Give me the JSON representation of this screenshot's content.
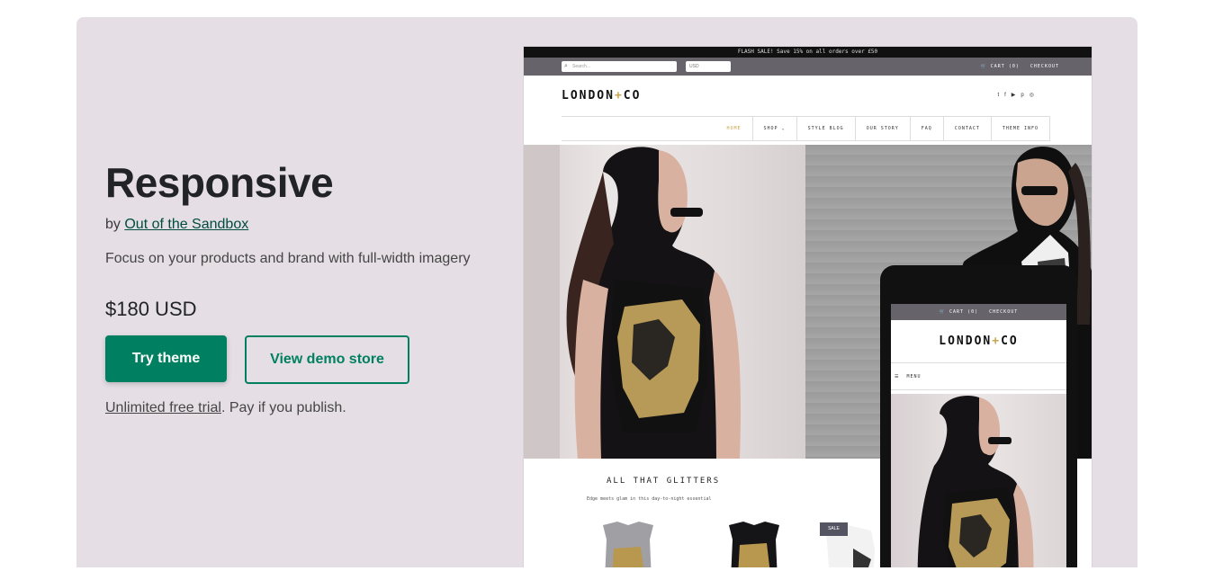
{
  "theme": {
    "title": "Responsive",
    "by_prefix": "by ",
    "author": "Out of the Sandbox",
    "description": "Focus on your products and brand with full-width imagery",
    "price": "$180 USD",
    "try_label": "Try theme",
    "demo_label": "View demo store",
    "trial_link": "Unlimited free trial",
    "trial_rest": ". Pay if you publish."
  },
  "preview": {
    "flash": "FLASH SALE! Save 15% on all orders over £50",
    "search_placeholder": "Search...",
    "currency": "USD",
    "cart": "CART (0)",
    "checkout": "CHECKOUT",
    "logo_left": "LONDON",
    "logo_plus": "+",
    "logo_right": "CO",
    "nav": [
      "HOME",
      "SHOP",
      "STYLE BLOG",
      "OUR STORY",
      "FAQ",
      "CONTACT",
      "THEME INFO"
    ],
    "section_title": "ALL THAT GLITTERS",
    "section_sub": "Edge meets glam in this day-to-night essential",
    "sale_badge": "SALE",
    "mobile_cart": "CART (0)",
    "mobile_checkout": "CHECKOUT",
    "mobile_menu": "MENU"
  },
  "colors": {
    "hero_bg": "#e5dfe5",
    "primary": "#008060",
    "accent_gold": "#c9a54c",
    "topbar": "#66636b"
  },
  "icons": [
    "search-icon",
    "cart-icon",
    "chevron-down-icon",
    "twitter-icon",
    "facebook-icon",
    "youtube-icon",
    "pinterest-icon",
    "instagram-icon",
    "hamburger-icon"
  ]
}
